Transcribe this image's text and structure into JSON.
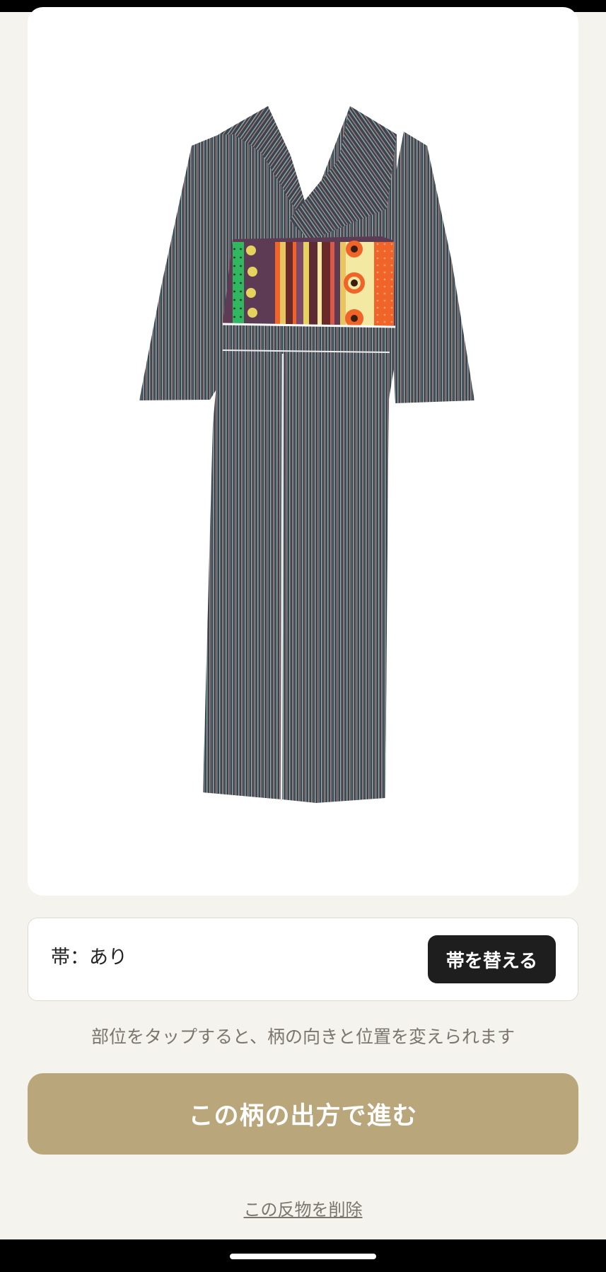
{
  "preview": {
    "garment": "kimono-with-obi",
    "colors": {
      "kimono_base": "#3b4550",
      "kimono_stripe_light": "#9aa8a6",
      "kimono_stripe_red": "#b48a86",
      "obi_green": "#2fb860",
      "obi_purple": "#5e3b55",
      "obi_yellow": "#e6d35d",
      "obi_orange": "#f0642a",
      "obi_cream": "#f4e9a2"
    }
  },
  "obi": {
    "status_label": "帯：あり",
    "change_button_label": "帯を替える"
  },
  "hint": "部位をタップすると、柄の向きと位置を変えられます",
  "primary_action": {
    "label": "この柄の出方で進む",
    "color": "#b9a67b"
  },
  "delete_link": "この反物を削除"
}
